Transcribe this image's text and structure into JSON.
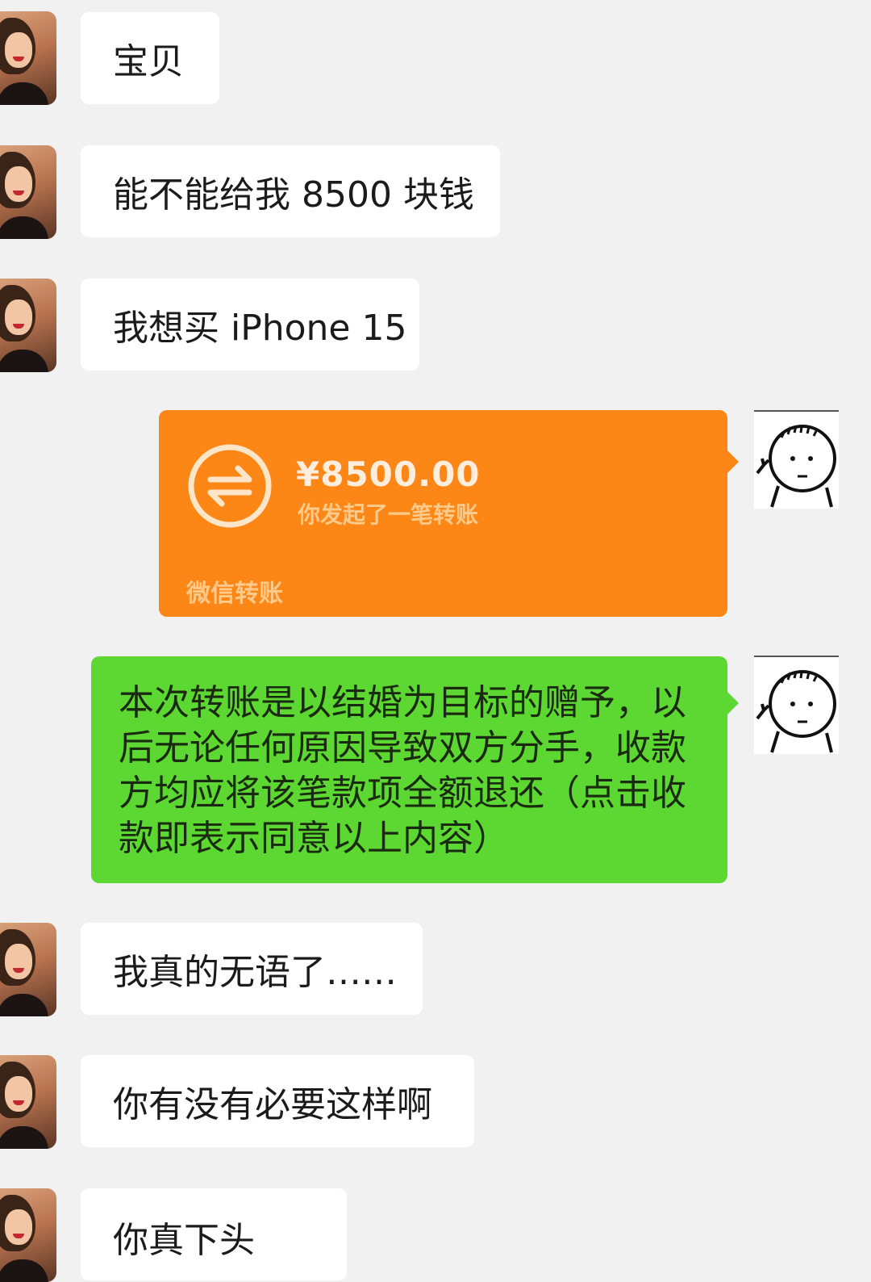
{
  "messages_incoming_top": [
    {
      "text": "宝贝"
    },
    {
      "text": "能不能给我 8500 块钱"
    },
    {
      "text": "我想买 iPhone 15"
    }
  ],
  "transfer": {
    "amount": "¥8500.00",
    "description": "你发起了一笔转账",
    "brand": "微信转账",
    "color": "#fc8616"
  },
  "terms_message": "本次转账是以结婚为目标的赠予，以后无论任何原因导致双方分手，收款方均应将该笔款项全额退还（点击收款即表示同意以上内容）",
  "messages_incoming_bottom": [
    {
      "text": "我真的无语了……"
    },
    {
      "text": "你有没有必要这样啊"
    },
    {
      "text": "你真下头"
    }
  ],
  "colors": {
    "background": "#f1f1f1",
    "incoming_bubble": "#ffffff",
    "outgoing_bubble": "#5dd832"
  },
  "icons": {
    "left_avatar": "woman-photo-avatar",
    "right_avatar": "stick-figure-avatar",
    "transfer": "transfer-arrows-icon"
  }
}
